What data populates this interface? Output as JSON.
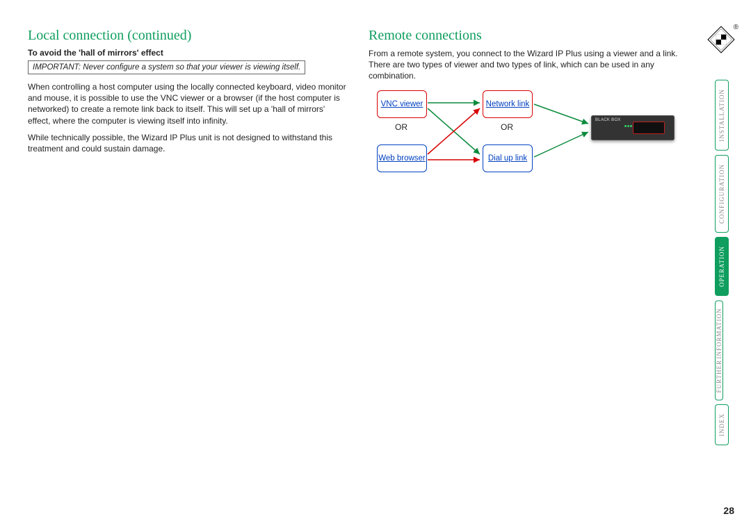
{
  "left": {
    "heading": "Local connection (continued)",
    "subhead": "To avoid the 'hall of mirrors' effect",
    "important": "IMPORTANT: Never configure a system so that your viewer is viewing itself.",
    "p1": "When controlling a host computer using the locally connected keyboard, video monitor and mouse, it is possible to use the VNC viewer or a browser (if the host computer is networked) to create a remote link back to itself. This will set up a 'hall of mirrors' effect, where the computer is viewing itself into infinity.",
    "p2": "While technically possible, the Wizard IP Plus unit is not designed to withstand this treatment and could sustain damage."
  },
  "right": {
    "heading": "Remote connections",
    "p1": "From a remote system, you connect to the Wizard IP Plus using a viewer and a link. There are two types of viewer and two types of link, which can be used in any combination."
  },
  "diagram": {
    "vnc": "VNC viewer",
    "web": "Web browser",
    "net": "Network link",
    "dial": "Dial up link",
    "or": "OR",
    "device_label": "BLACK BOX"
  },
  "nav": {
    "installation": "INSTALLATION",
    "configuration": "CONFIGURATION",
    "operation": "OPERATION",
    "further1": "FURTHER",
    "further2": "INFORMATION",
    "index": "INDEX"
  },
  "page_number": "28",
  "reg": "®"
}
